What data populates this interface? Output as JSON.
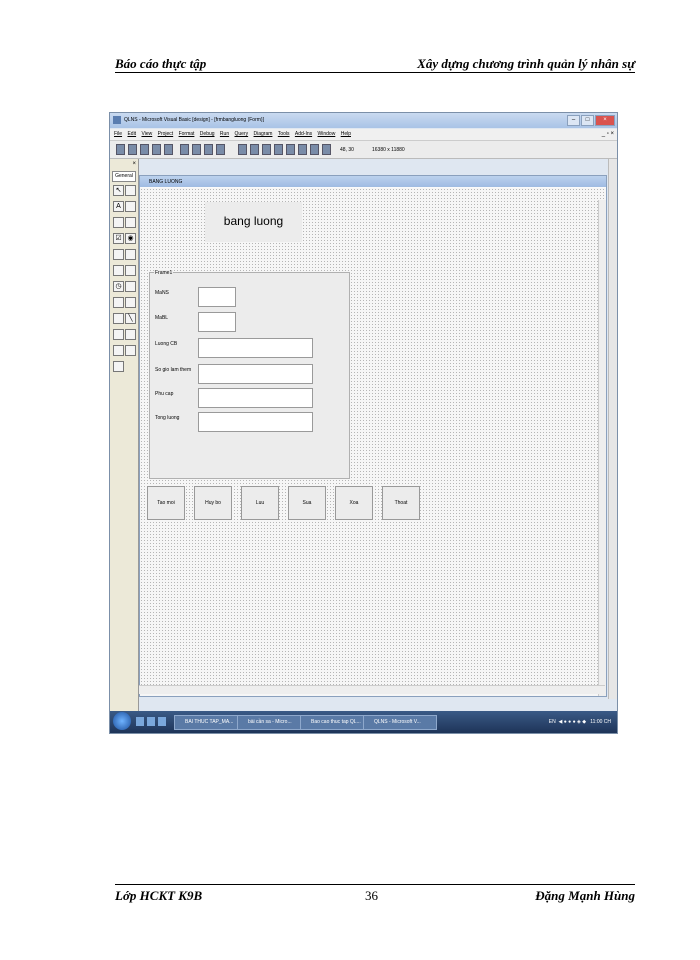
{
  "header": {
    "left": "Báo cáo thực tập",
    "right": "Xây dựng chương   trình quản lý nhân sự"
  },
  "footer": {
    "left": "Lớp HCKT K9B",
    "page": "36",
    "right": "Đặng   Mạnh Hùng"
  },
  "app": {
    "title": "QLNS - Microsoft Visual Basic [design] - [frmbangluong (Form)]",
    "menu": [
      "File",
      "Edit",
      "View",
      "Project",
      "Format",
      "Debug",
      "Run",
      "Query",
      "Diagram",
      "Tools",
      "Add-Ins",
      "Window",
      "Help"
    ],
    "toolbar": {
      "position": "48, 30",
      "size": "16380 x 11880"
    },
    "toolbox": {
      "tab": "General"
    }
  },
  "form": {
    "title": "BANG LUONG",
    "heading": "bang luong",
    "frame_caption": "Frame1",
    "fields": [
      {
        "label": "MaNS"
      },
      {
        "label": "MaBL"
      },
      {
        "label": "Luong CB"
      },
      {
        "label": "So gio lam them"
      },
      {
        "label": "Phu cap"
      },
      {
        "label": "Tong luong"
      }
    ],
    "buttons": [
      "Tao moi",
      "Huy bo",
      "Luu",
      "Sua",
      "Xoa",
      "Thoat"
    ]
  },
  "taskbar": {
    "items": [
      "BAI THUC TAP_MA...",
      "bài cần sa - Micro...",
      "Bao cao thuc tap QL...",
      "QLNS - Microsoft V..."
    ],
    "lang": "EN",
    "time": "11:00 CH"
  },
  "colors": {
    "titlebar": "#a9c3e6",
    "taskbar": "#1e3458",
    "form_bg": "#ececec"
  }
}
